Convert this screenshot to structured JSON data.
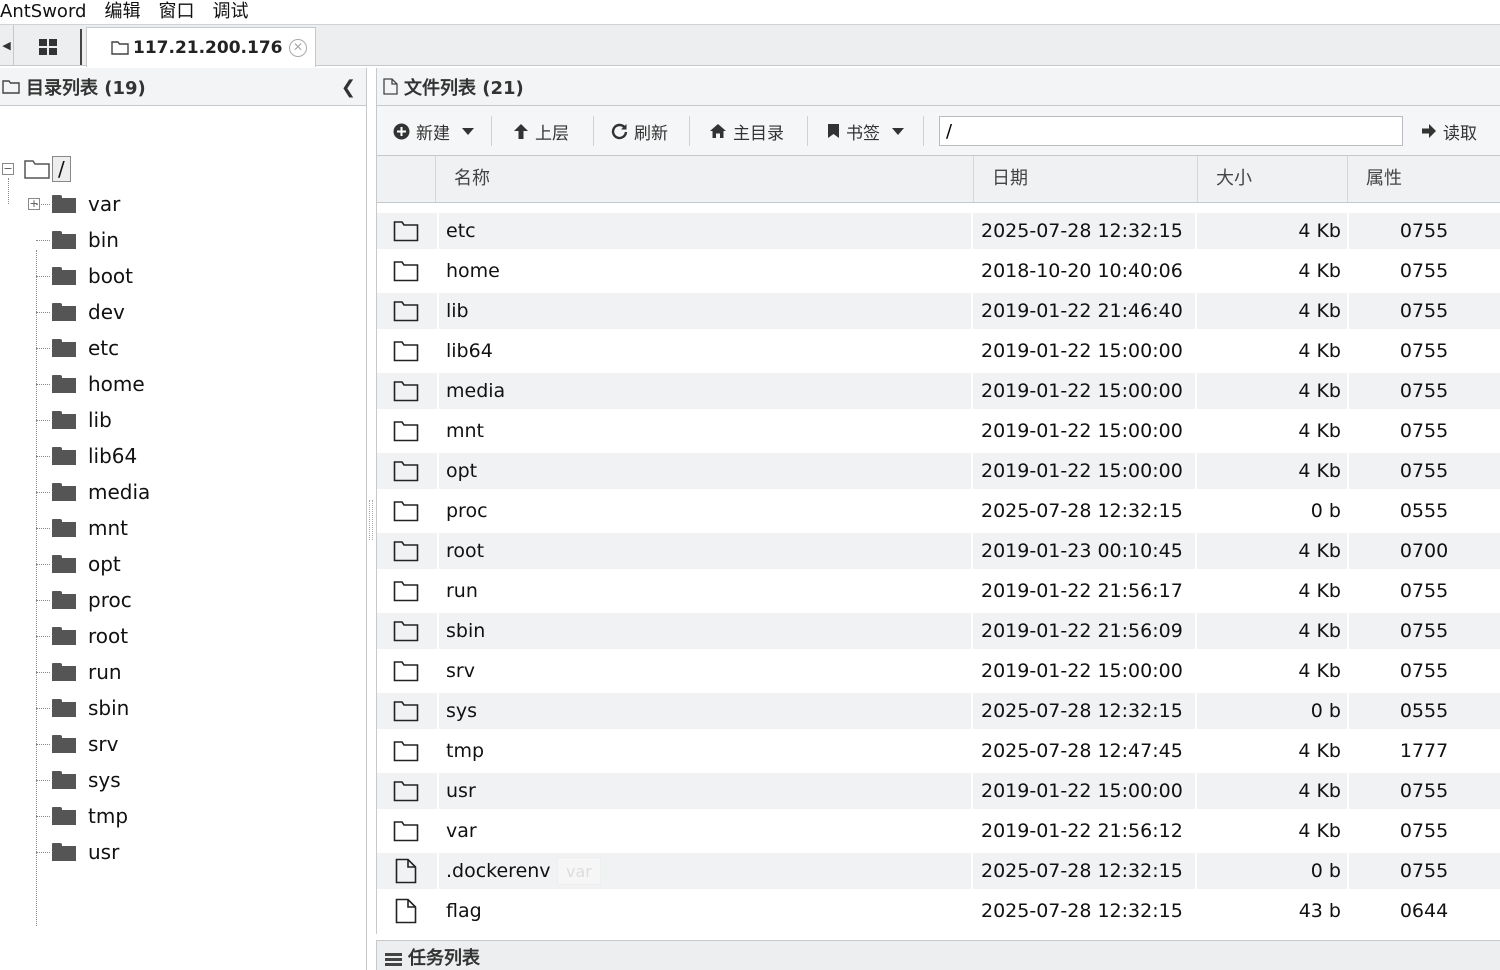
{
  "menu": [
    "AntSword",
    "编辑",
    "窗口",
    "调试"
  ],
  "tabs": {
    "active_label": "117.21.200.176"
  },
  "left_panel": {
    "title": "目录列表 (19)",
    "root": "/",
    "tree": [
      "var",
      "bin",
      "boot",
      "dev",
      "etc",
      "home",
      "lib",
      "lib64",
      "media",
      "mnt",
      "opt",
      "proc",
      "root",
      "run",
      "sbin",
      "srv",
      "sys",
      "tmp",
      "usr"
    ]
  },
  "right_panel": {
    "title": "文件列表 (21)",
    "toolbar": {
      "new": "新建",
      "up": "上层",
      "refresh": "刷新",
      "home": "主目录",
      "bookmark": "书签",
      "path": "/",
      "read": "读取"
    },
    "columns": [
      "名称",
      "日期",
      "大小",
      "属性"
    ],
    "files": [
      {
        "type": "folder",
        "name": "etc",
        "date": "2025-07-28 12:32:15",
        "size": "4 Kb",
        "attr": "0755"
      },
      {
        "type": "folder",
        "name": "home",
        "date": "2018-10-20 10:40:06",
        "size": "4 Kb",
        "attr": "0755"
      },
      {
        "type": "folder",
        "name": "lib",
        "date": "2019-01-22 21:46:40",
        "size": "4 Kb",
        "attr": "0755"
      },
      {
        "type": "folder",
        "name": "lib64",
        "date": "2019-01-22 15:00:00",
        "size": "4 Kb",
        "attr": "0755"
      },
      {
        "type": "folder",
        "name": "media",
        "date": "2019-01-22 15:00:00",
        "size": "4 Kb",
        "attr": "0755"
      },
      {
        "type": "folder",
        "name": "mnt",
        "date": "2019-01-22 15:00:00",
        "size": "4 Kb",
        "attr": "0755"
      },
      {
        "type": "folder",
        "name": "opt",
        "date": "2019-01-22 15:00:00",
        "size": "4 Kb",
        "attr": "0755"
      },
      {
        "type": "folder",
        "name": "proc",
        "date": "2025-07-28 12:32:15",
        "size": "0 b",
        "attr": "0555"
      },
      {
        "type": "folder",
        "name": "root",
        "date": "2019-01-23 00:10:45",
        "size": "4 Kb",
        "attr": "0700"
      },
      {
        "type": "folder",
        "name": "run",
        "date": "2019-01-22 21:56:17",
        "size": "4 Kb",
        "attr": "0755"
      },
      {
        "type": "folder",
        "name": "sbin",
        "date": "2019-01-22 21:56:09",
        "size": "4 Kb",
        "attr": "0755"
      },
      {
        "type": "folder",
        "name": "srv",
        "date": "2019-01-22 15:00:00",
        "size": "4 Kb",
        "attr": "0755"
      },
      {
        "type": "folder",
        "name": "sys",
        "date": "2025-07-28 12:32:15",
        "size": "0 b",
        "attr": "0555"
      },
      {
        "type": "folder",
        "name": "tmp",
        "date": "2025-07-28 12:47:45",
        "size": "4 Kb",
        "attr": "1777"
      },
      {
        "type": "folder",
        "name": "usr",
        "date": "2019-01-22 15:00:00",
        "size": "4 Kb",
        "attr": "0755"
      },
      {
        "type": "folder",
        "name": "var",
        "date": "2019-01-22 21:56:12",
        "size": "4 Kb",
        "attr": "0755"
      },
      {
        "type": "file",
        "name": ".dockerenv",
        "date": "2025-07-28 12:32:15",
        "size": "0 b",
        "attr": "0755"
      },
      {
        "type": "file",
        "name": "flag",
        "date": "2025-07-28 12:32:15",
        "size": "43 b",
        "attr": "0644"
      }
    ],
    "drag_tooltip": "var"
  },
  "task_panel": {
    "title": "任务列表"
  }
}
